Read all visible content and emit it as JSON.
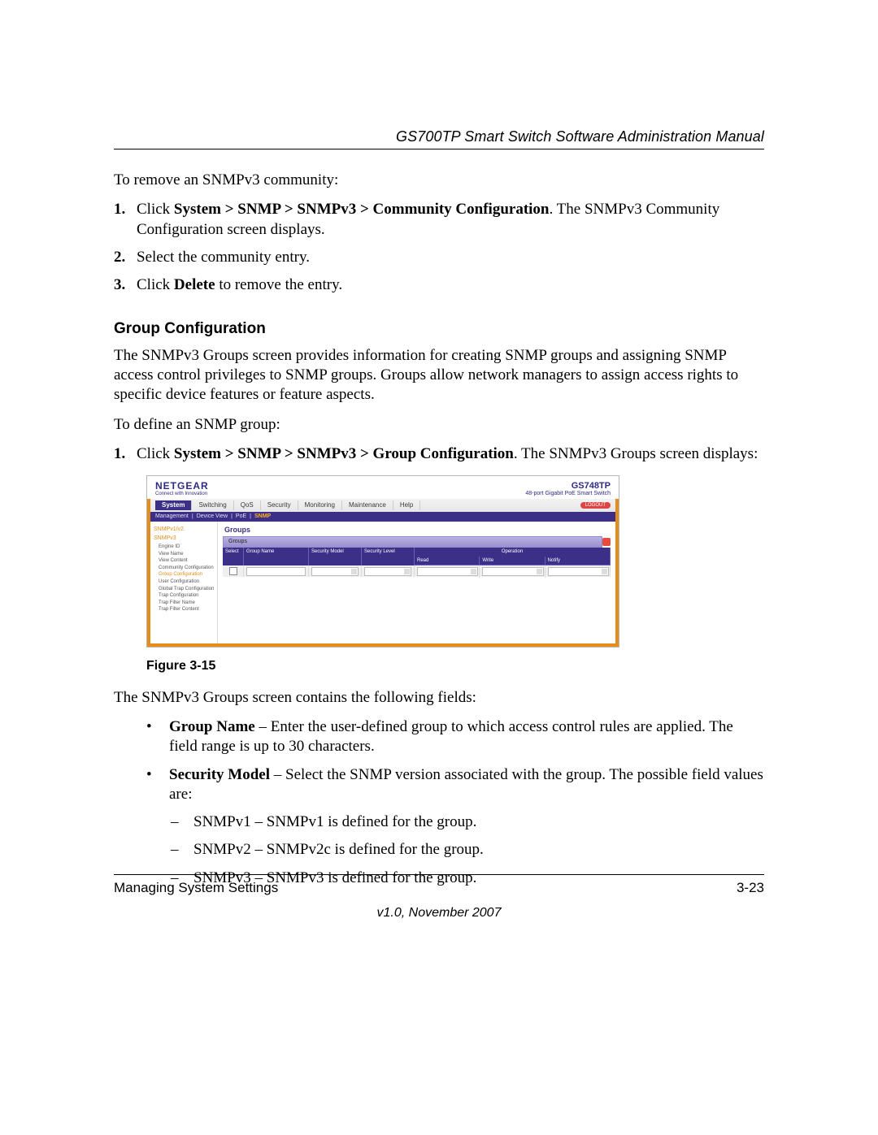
{
  "header": {
    "running_head": "GS700TP Smart Switch Software Administration Manual"
  },
  "intro": "To remove an SNMPv3 community:",
  "remove_steps": [
    {
      "num": "1.",
      "pre": "Click ",
      "bold": "System > SNMP > SNMPv3 > Community Configuration",
      "post": ". The SNMPv3 Community Configuration screen displays."
    },
    {
      "num": "2.",
      "pre": "Select the community entry.",
      "bold": "",
      "post": ""
    },
    {
      "num": "3.",
      "pre": "Click ",
      "bold": "Delete",
      "post": " to remove the entry."
    }
  ],
  "section_title": "Group Configuration",
  "section_para": "The SNMPv3 Groups screen provides information for creating SNMP groups and assigning SNMP access control privileges to SNMP groups. Groups allow network managers to assign access rights to specific device features or feature aspects.",
  "define_intro": "To define an SNMP group:",
  "define_steps": [
    {
      "num": "1.",
      "pre": "Click ",
      "bold": "System > SNMP > SNMPv3 > Group Configuration",
      "post": ". The SNMPv3 Groups screen displays:"
    }
  ],
  "figure": {
    "caption": "Figure 3-15",
    "ui": {
      "brand": "NETGEAR",
      "tagline": "Connect with Innovation",
      "model_code": "GS748TP",
      "model_desc": "48-port Gigabit PoE Smart Switch",
      "logout": "LOGOUT",
      "tabs": [
        "System",
        "Switching",
        "QoS",
        "Security",
        "Monitoring",
        "Maintenance",
        "Help"
      ],
      "active_tab": "System",
      "subtabs_left": [
        "Management",
        "Device View",
        "PoE"
      ],
      "subtab_hi": "SNMP",
      "side": {
        "sec1": "SNMPv1/v2",
        "sec2": "SNMPv3",
        "items": [
          "Engine ID",
          "View Name",
          "View Content",
          "Community Configuration",
          "Group Configuration",
          "User Configuration",
          "Global Trap Configuration",
          "Trap Configuration",
          "Trap Filter Name",
          "Trap Filter Content"
        ],
        "selected": "Group Configuration"
      },
      "panel_heading": "Groups",
      "panel_subhead": "Groups",
      "columns": {
        "select": "Select",
        "group_name": "Group Name",
        "security_model": "Security Model",
        "security_level": "Security Level",
        "operation": "Operation",
        "read": "Read",
        "write": "Write",
        "notify": "Notify"
      }
    }
  },
  "after_figure": "The SNMPv3 Groups screen contains the following fields:",
  "fields": [
    {
      "name": "Group Name",
      "desc": " – Enter the user-defined group to which access control rules are applied. The field range is up to 30 characters."
    },
    {
      "name": "Security Model",
      "desc": " – Select the SNMP version associated with the group. The possible field values are:"
    }
  ],
  "sm_values": [
    "SNMPv1 – SNMPv1 is defined for the group.",
    "SNMPv2 – SNMPv2c is defined for the group.",
    "SNMPv3 – SNMPv3 is defined for the group."
  ],
  "footer": {
    "left": "Managing System Settings",
    "right": "3-23",
    "version": "v1.0, November 2007"
  }
}
